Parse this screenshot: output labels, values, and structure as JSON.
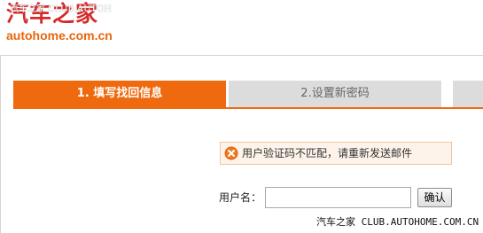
{
  "logo": {
    "name_cn": "汽车之家",
    "watermark": "汽车之家 CLUB.AUTOH",
    "url": "autohome.com.cn"
  },
  "tabs": [
    {
      "label": "1. 填写找回信息",
      "active": true
    },
    {
      "label": "2.设置新密码",
      "active": false
    },
    {
      "label": "",
      "active": false
    }
  ],
  "error": {
    "icon": "error-x-icon",
    "message": "用户验证码不匹配，请重新发送邮件"
  },
  "form": {
    "username_label": "用户名：",
    "username_value": "",
    "confirm_label": "确认"
  },
  "watermark_bottom": "汽车之家 CLUB.AUTOHOME.COM.CN",
  "colors": {
    "accent": "#ef6a0f",
    "tab_inactive": "#dcdcdc",
    "logo_red": "#d42a2a",
    "error_bg": "#fdf3ea"
  }
}
